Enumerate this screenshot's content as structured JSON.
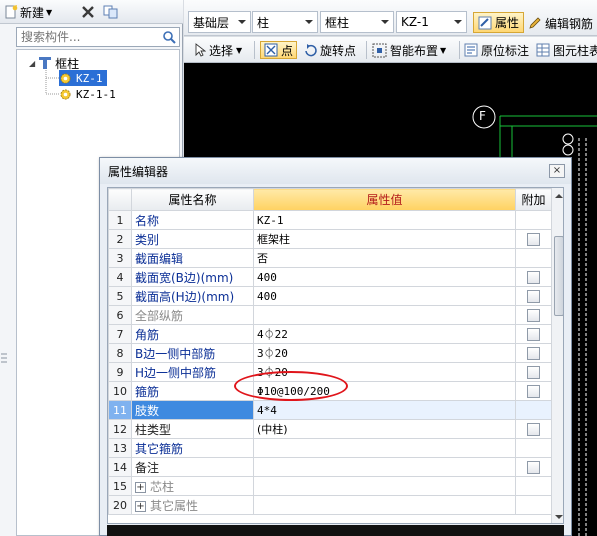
{
  "toolbar_left": {
    "new_label": "新建",
    "delete_icon": "close-x-icon",
    "copy_icon": "copy-icon"
  },
  "search": {
    "placeholder": "搜索构件..."
  },
  "tree": {
    "root": "框柱",
    "items": [
      "KZ-1",
      "KZ-1-1"
    ],
    "selected": "KZ-1"
  },
  "top_toolbar": {
    "layer": "基础层",
    "category": "柱",
    "type": "框柱",
    "element": "KZ-1",
    "property_button": "属性",
    "edit_rebar_button": "编辑钢筋"
  },
  "toolbar2": {
    "select": "选择",
    "point": "点",
    "rotate_point": "旋转点",
    "smart_layout": "智能布置",
    "original_label": "原位标注",
    "element_table": "图元柱表"
  },
  "canvas": {
    "axis_label": "F",
    "accent": "#19c23a"
  },
  "dialog": {
    "title": "属性编辑器",
    "close": "×",
    "headers": {
      "num": "",
      "name": "属性名称",
      "value": "属性值",
      "extra": "附加"
    },
    "rows": [
      {
        "num": "1",
        "name": "名称",
        "value": "KZ-1",
        "check": false,
        "style": "blue"
      },
      {
        "num": "2",
        "name": "类别",
        "value": "框架柱",
        "check": true,
        "style": "blue"
      },
      {
        "num": "3",
        "name": "截面编辑",
        "value": "否",
        "check": false,
        "style": "blue"
      },
      {
        "num": "4",
        "name": "截面宽(B边)(mm)",
        "value": "400",
        "check": true,
        "style": "blue"
      },
      {
        "num": "5",
        "name": "截面高(H边)(mm)",
        "value": "400",
        "check": true,
        "style": "blue"
      },
      {
        "num": "6",
        "name": "全部纵筋",
        "value": "",
        "check": true,
        "style": "gray"
      },
      {
        "num": "7",
        "name": "角筋",
        "value": "4⏀22",
        "check": true,
        "style": "blue"
      },
      {
        "num": "8",
        "name": "B边一侧中部筋",
        "value": "3⏀20",
        "check": true,
        "style": "blue"
      },
      {
        "num": "9",
        "name": "H边一侧中部筋",
        "value": "3⏀20",
        "check": true,
        "style": "blue"
      },
      {
        "num": "10",
        "name": "箍筋",
        "value": "Φ10@100/200",
        "check": true,
        "style": "blue"
      },
      {
        "num": "11",
        "name": "肢数",
        "value": "4*4",
        "check": false,
        "style": "selected"
      },
      {
        "num": "12",
        "name": "柱类型",
        "value": "(中柱)",
        "check": true,
        "style": "common"
      },
      {
        "num": "13",
        "name": "其它箍筋",
        "value": "",
        "check": false,
        "style": "blue"
      },
      {
        "num": "14",
        "name": "备注",
        "value": "",
        "check": true,
        "style": "common"
      },
      {
        "num": "15",
        "name": "芯柱",
        "value": "",
        "check": false,
        "style": "group"
      },
      {
        "num": "20",
        "name": "其它属性",
        "value": "",
        "check": false,
        "style": "group"
      }
    ]
  }
}
